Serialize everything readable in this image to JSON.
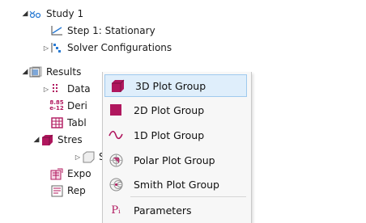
{
  "tree": {
    "study": {
      "label": "Study 1",
      "icon": "study-icon"
    },
    "step": {
      "label": "Step 1: Stationary",
      "icon": "stationary-step-icon"
    },
    "solver": {
      "label": "Solver Configurations",
      "icon": "solver-configurations-icon"
    },
    "results": {
      "label": "Results",
      "icon": "results-icon"
    },
    "datasets": {
      "label": "Data",
      "icon": "datasets-icon"
    },
    "derived": {
      "label": "Deri",
      "icon_text": "8.85\ne-12",
      "icon": "derived-values-icon"
    },
    "tables": {
      "label": "Tabl",
      "icon": "tables-icon"
    },
    "stress": {
      "label": "Stres",
      "icon": "stress-plot-group-icon"
    },
    "stress_child": {
      "label": "S",
      "icon": "surface-plot-icon"
    },
    "export": {
      "label": "Expo",
      "icon": "export-icon"
    },
    "reports": {
      "label": "Rep",
      "icon": "reports-icon"
    }
  },
  "menu": {
    "items": [
      {
        "label": "3D Plot Group",
        "icon": "3d-plot-group-icon",
        "highlighted": true
      },
      {
        "label": "2D Plot Group",
        "icon": "2d-plot-group-icon"
      },
      {
        "label": "1D Plot Group",
        "icon": "1d-plot-group-icon"
      },
      {
        "label": "Polar Plot Group",
        "icon": "polar-plot-group-icon"
      },
      {
        "label": "Smith Plot Group",
        "icon": "smith-plot-group-icon"
      },
      {
        "label": "Parameters",
        "icon": "parameters-icon",
        "icon_text": "Pᵢ"
      }
    ]
  },
  "colors": {
    "accent": "#b0175e",
    "highlight_bg": "#dfeefb",
    "highlight_border": "#9fc9ee"
  }
}
